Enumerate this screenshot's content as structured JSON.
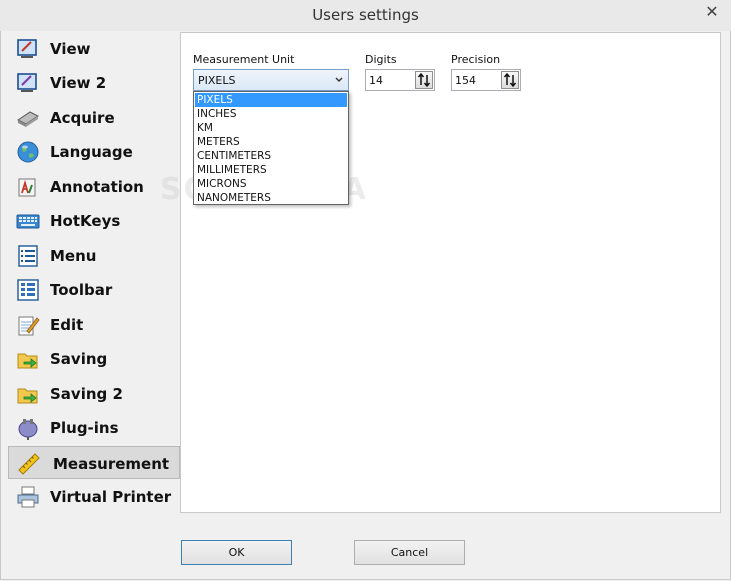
{
  "window": {
    "title": "Users settings",
    "close_glyph": "✕"
  },
  "sidebar": {
    "items": [
      {
        "label": "View",
        "icon": "view-icon"
      },
      {
        "label": "View 2",
        "icon": "view2-icon"
      },
      {
        "label": "Acquire",
        "icon": "scanner-icon"
      },
      {
        "label": "Language",
        "icon": "globe-icon"
      },
      {
        "label": "Annotation",
        "icon": "annotation-icon"
      },
      {
        "label": "HotKeys",
        "icon": "keyboard-icon"
      },
      {
        "label": "Menu",
        "icon": "menu-icon"
      },
      {
        "label": "Toolbar",
        "icon": "toolbar-icon"
      },
      {
        "label": "Edit",
        "icon": "edit-icon"
      },
      {
        "label": "Saving",
        "icon": "saving-icon"
      },
      {
        "label": "Saving 2",
        "icon": "saving2-icon"
      },
      {
        "label": "Plug-ins",
        "icon": "plugin-icon"
      },
      {
        "label": "Measurement",
        "icon": "ruler-icon",
        "active": true
      },
      {
        "label": "Virtual Printer",
        "icon": "printer-icon"
      }
    ]
  },
  "measurement": {
    "unit_label": "Measurement Unit",
    "unit_value": "PIXELS",
    "unit_options": [
      "PIXELS",
      "INCHES",
      "KM",
      "METERS",
      "CENTIMETERS",
      "MILLIMETERS",
      "MICRONS",
      "NANOMETERS"
    ],
    "digits_label": "Digits",
    "digits_value": "14",
    "precision_label": "Precision",
    "precision_value": "154"
  },
  "footer": {
    "ok_label": "OK",
    "cancel_label": "Cancel"
  },
  "watermark": "SOFTPEDIA"
}
